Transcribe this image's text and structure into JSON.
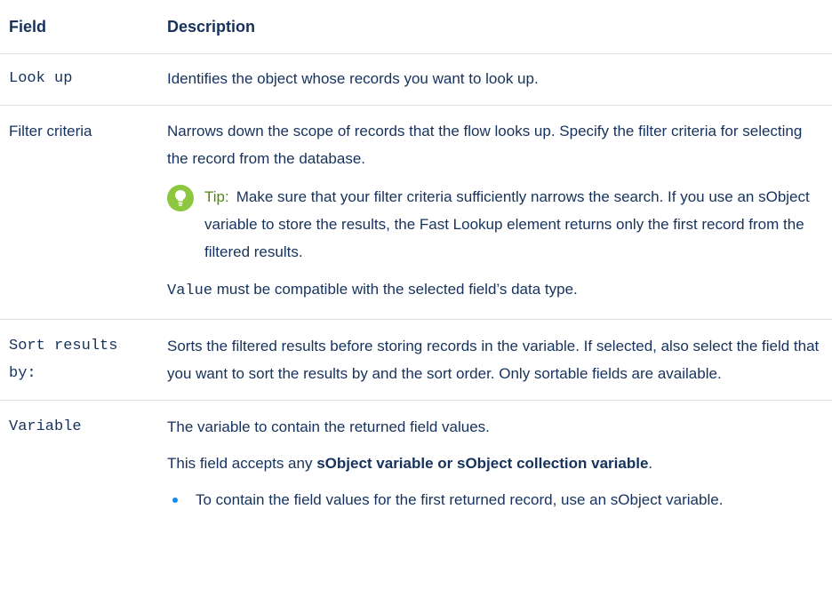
{
  "header": {
    "field": "Field",
    "description": "Description"
  },
  "rows": {
    "lookup": {
      "field": "Look up",
      "desc": "Identifies the object whose records you want to look up."
    },
    "filter": {
      "field": "Filter criteria",
      "desc": "Narrows down the scope of records that the flow looks up. Specify the filter criteria for selecting the record from the database.",
      "tip_label": "Tip:",
      "tip_text": "Make sure that your filter criteria sufficiently narrows the search. If you use an sObject variable to store the results, the Fast Lookup element returns only the first record from the filtered results.",
      "value_code": "Value",
      "value_text": " must be compatible with the selected field’s data type."
    },
    "sort": {
      "field": "Sort results by:",
      "desc": "Sorts the filtered results before storing records in the variable. If selected, also select the field that you want to sort the results by and the sort order. Only sortable fields are available."
    },
    "variable": {
      "field": "Variable",
      "desc": "The variable to contain the returned field values.",
      "accepts_prefix": "This field accepts any ",
      "accepts_bold": "sObject variable or sObject collection variable",
      "accepts_suffix": ".",
      "bullets": [
        "To contain the field values for the first returned record, use an sObject variable."
      ]
    }
  },
  "colors": {
    "text": "#16325c",
    "tip_label": "#4d8a0f",
    "tip_icon": "#8dc63f",
    "bullet": "#1589ee",
    "divider": "#d8dde6"
  }
}
